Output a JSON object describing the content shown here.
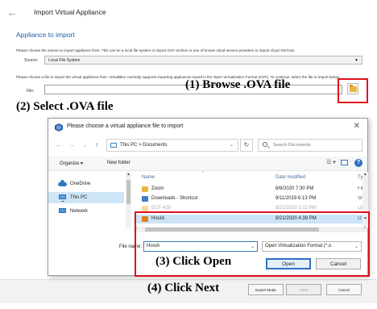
{
  "wizard": {
    "title": "Import Virtual Appliance",
    "section_title": "Appliance to import",
    "desc1": "Please choose the source to import appliance from. This can be a local file system to import OVF archive or one of known cloud service providers to import cloud VM from.",
    "source_label": "Source:",
    "source_value": "Local File System",
    "desc2": "Please choose a file to import the virtual appliance from. VirtualBox currently supports importing appliances saved in the Open Virtualization Format (OVF). To continue, select the file to import below.",
    "file_label": "File:",
    "file_value": "",
    "buttons": {
      "expert": "Expert Mode",
      "next": "Next",
      "cancel": "Cancel"
    }
  },
  "callouts": {
    "step1": "(1)  Browse .OVA file",
    "step2": "(2) Select .OVA file",
    "step3": "(3) Click Open",
    "step4": "(4) Click Next"
  },
  "dialog": {
    "title": "Please choose a virtual appliance file to import",
    "breadcrumb": "This PC  >  Documents",
    "search_placeholder": "Search Documents",
    "toolbar": {
      "organize": "Organize ▾",
      "new_folder": "New folder"
    },
    "nav_items": [
      "OneDrive",
      "This PC",
      "Network"
    ],
    "columns": {
      "name": "Name",
      "date": "Date modified",
      "type": "Ty"
    },
    "files": [
      {
        "name": "Zoom",
        "date": "8/9/2020 7:30 PM",
        "type": "Fil",
        "icon": "folder-icon"
      },
      {
        "name": "Downloads - Shortcut",
        "date": "9/11/2019 6:13 PM",
        "type": "Sh",
        "icon": "shortcut-icon"
      },
      {
        "name": "ECF-429",
        "date": "8/21/2020 3:12 PM",
        "type": "Or",
        "icon": "folder-icon"
      },
      {
        "name": "HostA",
        "date": "8/21/2020 4:39 PM",
        "type": "O",
        "icon": "ova-file-icon"
      }
    ],
    "file_name_label": "File name:",
    "file_name_value": "HostA",
    "file_type_value": "Open Virtualization Format (*.o",
    "open_label": "Open",
    "cancel_label": "Cancel"
  },
  "colors": {
    "accent": "#2f6fc2",
    "callout_box": "#e0101c",
    "section_title": "#1f5fa8"
  }
}
